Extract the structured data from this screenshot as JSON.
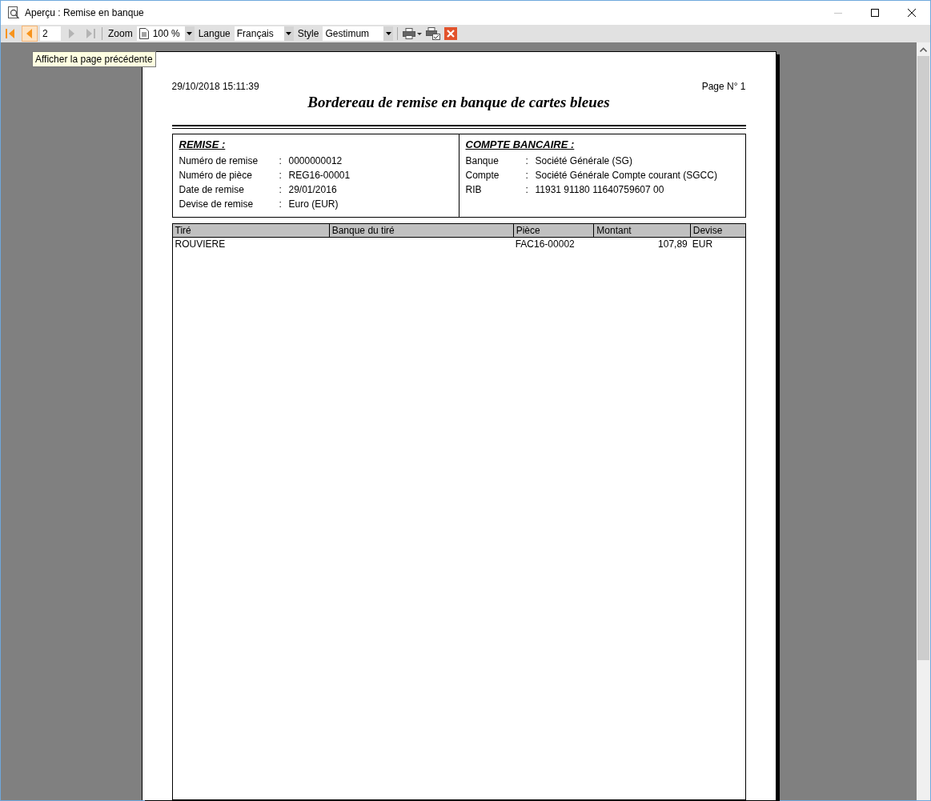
{
  "window": {
    "title": "Aperçu : Remise en banque"
  },
  "toolbar": {
    "nav_buttons": [
      {
        "kind": "first",
        "disabled": false,
        "selected": false
      },
      {
        "kind": "prev",
        "disabled": false,
        "selected": true
      },
      {
        "kind": "next",
        "disabled": true,
        "selected": false
      },
      {
        "kind": "last",
        "disabled": true,
        "selected": false
      }
    ],
    "page_field": "2",
    "zoom_label": "Zoom",
    "zoom_value": "100 %",
    "language_label": "Langue",
    "language_value": "Français",
    "style_label": "Style",
    "style_value": "Gestimum"
  },
  "tooltip": "Afficher la page précédente",
  "report": {
    "date": "29/10/2018 15:11:39",
    "page": "Page N° 1",
    "title": "Bordereau de remise en banque de cartes bleues",
    "remise": {
      "heading": "REMISE :",
      "rows": [
        {
          "label": "Numéro de remise",
          "separator": ":",
          "value": "0000000012"
        },
        {
          "label": "Numéro de pièce",
          "separator": ":",
          "value": "REG16-00001"
        },
        {
          "label": "Date de remise",
          "separator": ":",
          "value": "29/01/2016"
        },
        {
          "label": "Devise de remise",
          "separator": ":",
          "value": "Euro (EUR)"
        }
      ]
    },
    "compte": {
      "heading": "COMPTE BANCAIRE :",
      "rows": [
        {
          "label": "Banque",
          "separator": ":",
          "value": "Société Générale (SG)"
        },
        {
          "label": "Compte",
          "separator": ":",
          "value": "Société Générale Compte courant (SGCC)"
        },
        {
          "label": "RIB",
          "separator": ":",
          "value": "11931 91180 11640759607 00"
        }
      ]
    },
    "table": {
      "columns": [
        "Tiré",
        "Banque du tiré",
        "Pièce",
        "Montant",
        "Devise"
      ],
      "rows": [
        [
          "ROUVIERE",
          "",
          "FAC16-00002",
          "107,89",
          "EUR"
        ]
      ]
    }
  }
}
